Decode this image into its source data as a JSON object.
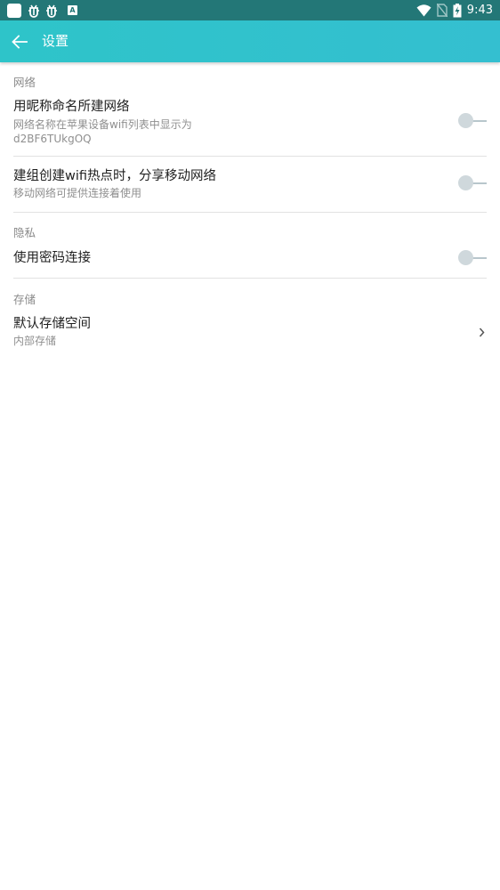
{
  "status_bar": {
    "time": "9:43",
    "notification_icons": [
      "app-icon",
      "bug-icon",
      "bug-icon",
      "a-icon"
    ],
    "a_icon_label": "A"
  },
  "app_bar": {
    "title": "设置",
    "back_icon": "arrow-left-icon"
  },
  "sections": {
    "network": {
      "header": "网络"
    },
    "privacy": {
      "header": "隐私"
    },
    "storage": {
      "header": "存储"
    }
  },
  "settings": {
    "nickname_network": {
      "title": "用昵称命名所建网络",
      "subtitle_line1": "网络名称在苹果设备wifi列表中显示为",
      "subtitle_line2": "d2BF6TUkgOQ",
      "enabled": false
    },
    "share_mobile": {
      "title": "建组创建wifi热点时，分享移动网络",
      "subtitle": "移动网络可提供连接着使用",
      "enabled": false
    },
    "password_connect": {
      "title": "使用密码连接",
      "enabled": false
    },
    "default_storage": {
      "title": "默认存储空间",
      "subtitle": "内部存储"
    }
  },
  "colors": {
    "status_bar": "#237777",
    "app_bar": "#2ec4c9",
    "toggle_off": "#cfd8dc"
  }
}
